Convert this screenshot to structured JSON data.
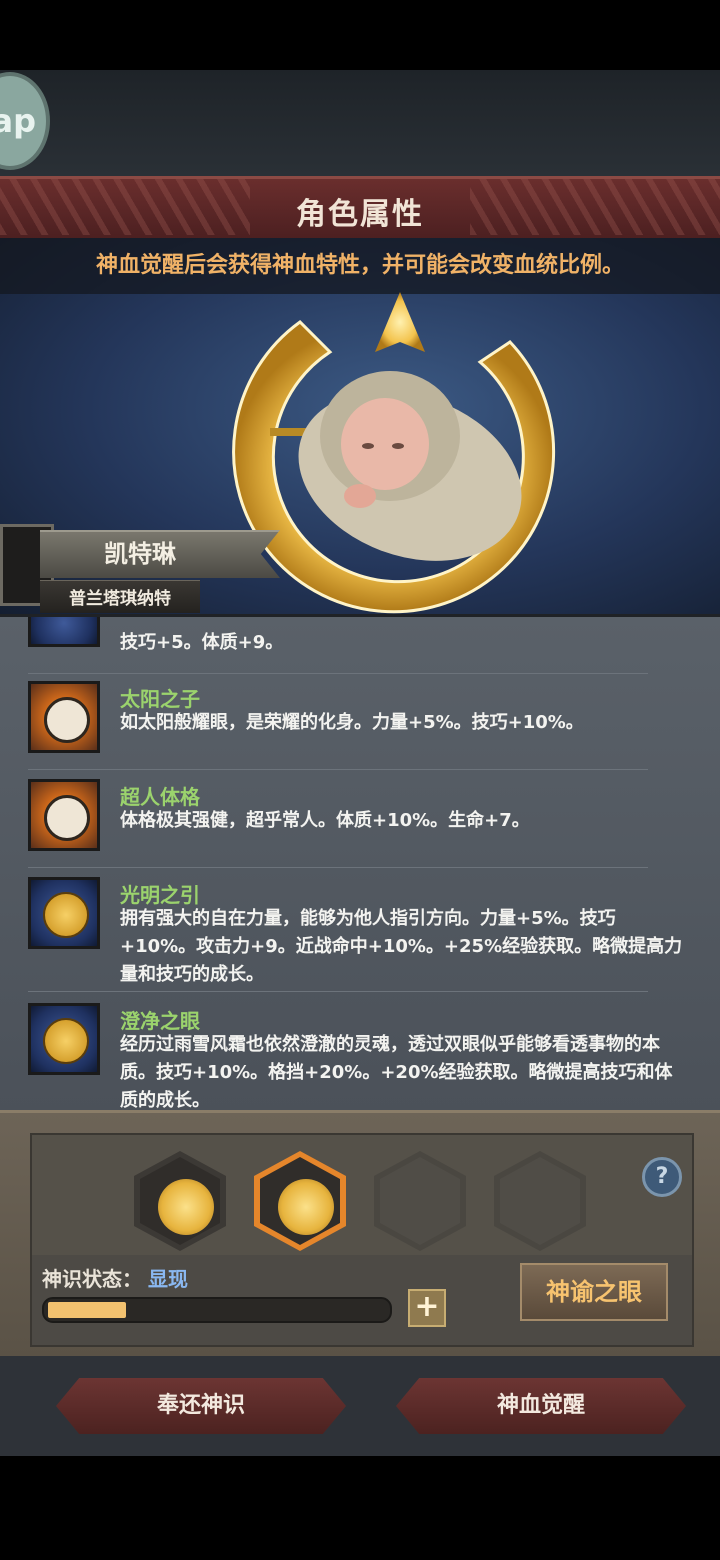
{
  "topbar": {
    "ap_label": "ap"
  },
  "title": "角色属性",
  "hint": "神血觉醒后会获得神血特性，并可能会改变血统比例。",
  "character": {
    "name": "凯特琳",
    "origin": "普兰塔琪纳特"
  },
  "traits": [
    {
      "name": "",
      "icon": "blue-emblem-icon",
      "desc": "技巧+5。体质+9。"
    },
    {
      "name": "太阳之子",
      "icon": "smiling-sun-icon",
      "desc": "如太阳般耀眼，是荣耀的化身。力量+5%。技巧+10%。"
    },
    {
      "name": "超人体格",
      "icon": "smiling-sun-icon",
      "desc": "体格极其强健，超乎常人。体质+10%。生命+7。"
    },
    {
      "name": "光明之引",
      "icon": "gold-medallion-icon",
      "desc": "拥有强大的自在力量，能够为他人指引方向。力量+5%。技巧+10%。攻击力+9。近战命中+10%。+25%经验获取。略微提高力量和技巧的成长。"
    },
    {
      "name": "澄净之眼",
      "icon": "gold-medallion-icon",
      "desc": "经历过雨雪风霜也依然澄澈的灵魂，透过双眼似乎能够看透事物的本质。技巧+10%。格挡+20%。+20%经验获取。略微提高技巧和体质的成长。"
    }
  ],
  "slots": {
    "help": "?",
    "filled_count": 2,
    "selected_index": 1
  },
  "status": {
    "label": "神识状态：",
    "value": "显现",
    "progress": 0.23,
    "plus": "+"
  },
  "oracle_button": "神谕之眼",
  "actions": {
    "return": "奉还神识",
    "awaken": "神血觉醒"
  }
}
